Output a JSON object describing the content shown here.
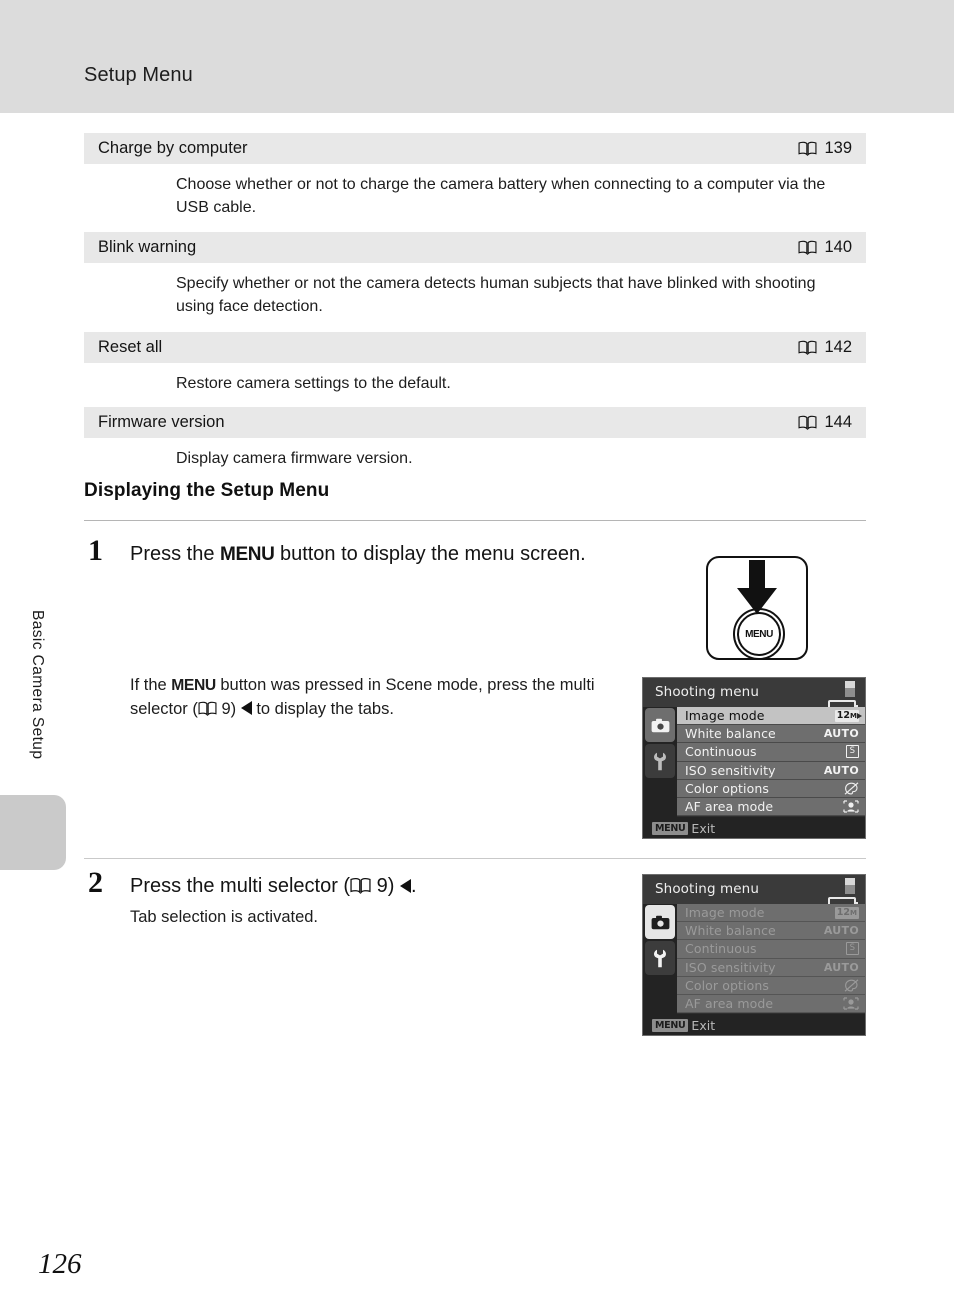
{
  "header": {
    "title": "Setup Menu"
  },
  "side_tab": {
    "label": "Basic Camera Setup"
  },
  "reference_table": {
    "rows": [
      {
        "title": "Charge by computer",
        "ref_icon": "book-icon",
        "page": "139",
        "body": "Choose whether or not to charge the camera battery when connecting to a computer via the USB cable."
      },
      {
        "title": "Blink warning",
        "ref_icon": "book-icon",
        "page": "140",
        "body": "Specify whether or not the camera detects human subjects that have blinked with shooting using face detection."
      },
      {
        "title": "Reset all",
        "ref_icon": "book-icon",
        "page": "142",
        "body": "Restore camera settings to the default."
      },
      {
        "title": "Firmware version",
        "ref_icon": "book-icon",
        "page": "144",
        "body": "Display camera firmware version."
      }
    ]
  },
  "section": {
    "heading": "Displaying the Setup Menu"
  },
  "steps": [
    {
      "number": "1",
      "title_a": "Press the ",
      "title_menu": "MENU",
      "title_b": " button to display the menu screen.",
      "sub_a": "If the ",
      "sub_menu": "MENU",
      "sub_b": " button was pressed in Scene mode, press the multi selector (",
      "sub_page": "9",
      "sub_c": ") ",
      "sub_d": " to display the tabs."
    },
    {
      "number": "2",
      "title_a": "Press the multi selector (",
      "title_page": "9",
      "title_b": ") ",
      "title_c": ".",
      "sub": "Tab selection is activated."
    }
  ],
  "button_illustration": {
    "label": "MENU",
    "arrow": "arrow-down-icon"
  },
  "lcd_screens": [
    {
      "title": "Shooting menu",
      "tabs": [
        {
          "icon": "camera-icon",
          "state": "selected"
        },
        {
          "icon": "wrench-icon",
          "state": "normal"
        }
      ],
      "items": [
        {
          "label": "Image mode",
          "value": "12",
          "value_sub": "M",
          "value_type": "badge",
          "selected": true,
          "has_arrow": true
        },
        {
          "label": "White balance",
          "value": "AUTO",
          "value_type": "text",
          "selected": false
        },
        {
          "label": "Continuous",
          "value": "S",
          "value_type": "box",
          "selected": false
        },
        {
          "label": "ISO sensitivity",
          "value": "AUTO",
          "value_type": "text",
          "selected": false
        },
        {
          "label": "Color options",
          "value": "color-options-icon",
          "value_type": "icon",
          "selected": false
        },
        {
          "label": "AF area mode",
          "value": "af-area-icon",
          "value_type": "icon",
          "selected": false
        }
      ],
      "footer": {
        "chip": "MENU",
        "label": "Exit"
      },
      "status": {
        "battery": "battery-icon",
        "scrollbar": "scrollbar-icon"
      }
    },
    {
      "title": "Shooting menu",
      "tabs": [
        {
          "icon": "camera-icon",
          "state": "highlighted"
        },
        {
          "icon": "wrench-icon",
          "state": "normal"
        }
      ],
      "items": [
        {
          "label": "Image mode",
          "value": "12",
          "value_sub": "M",
          "value_type": "badge",
          "selected": false
        },
        {
          "label": "White balance",
          "value": "AUTO",
          "value_type": "text",
          "selected": false
        },
        {
          "label": "Continuous",
          "value": "S",
          "value_type": "box",
          "selected": false
        },
        {
          "label": "ISO sensitivity",
          "value": "AUTO",
          "value_type": "text",
          "selected": false
        },
        {
          "label": "Color options",
          "value": "color-options-icon",
          "value_type": "icon",
          "selected": false
        },
        {
          "label": "AF area mode",
          "value": "af-area-icon",
          "value_type": "icon",
          "selected": false
        }
      ],
      "footer": {
        "chip": "MENU",
        "label": "Exit"
      },
      "status": {
        "battery": "battery-icon",
        "scrollbar": "scrollbar-icon"
      }
    }
  ],
  "footer": {
    "page_number": "126"
  }
}
